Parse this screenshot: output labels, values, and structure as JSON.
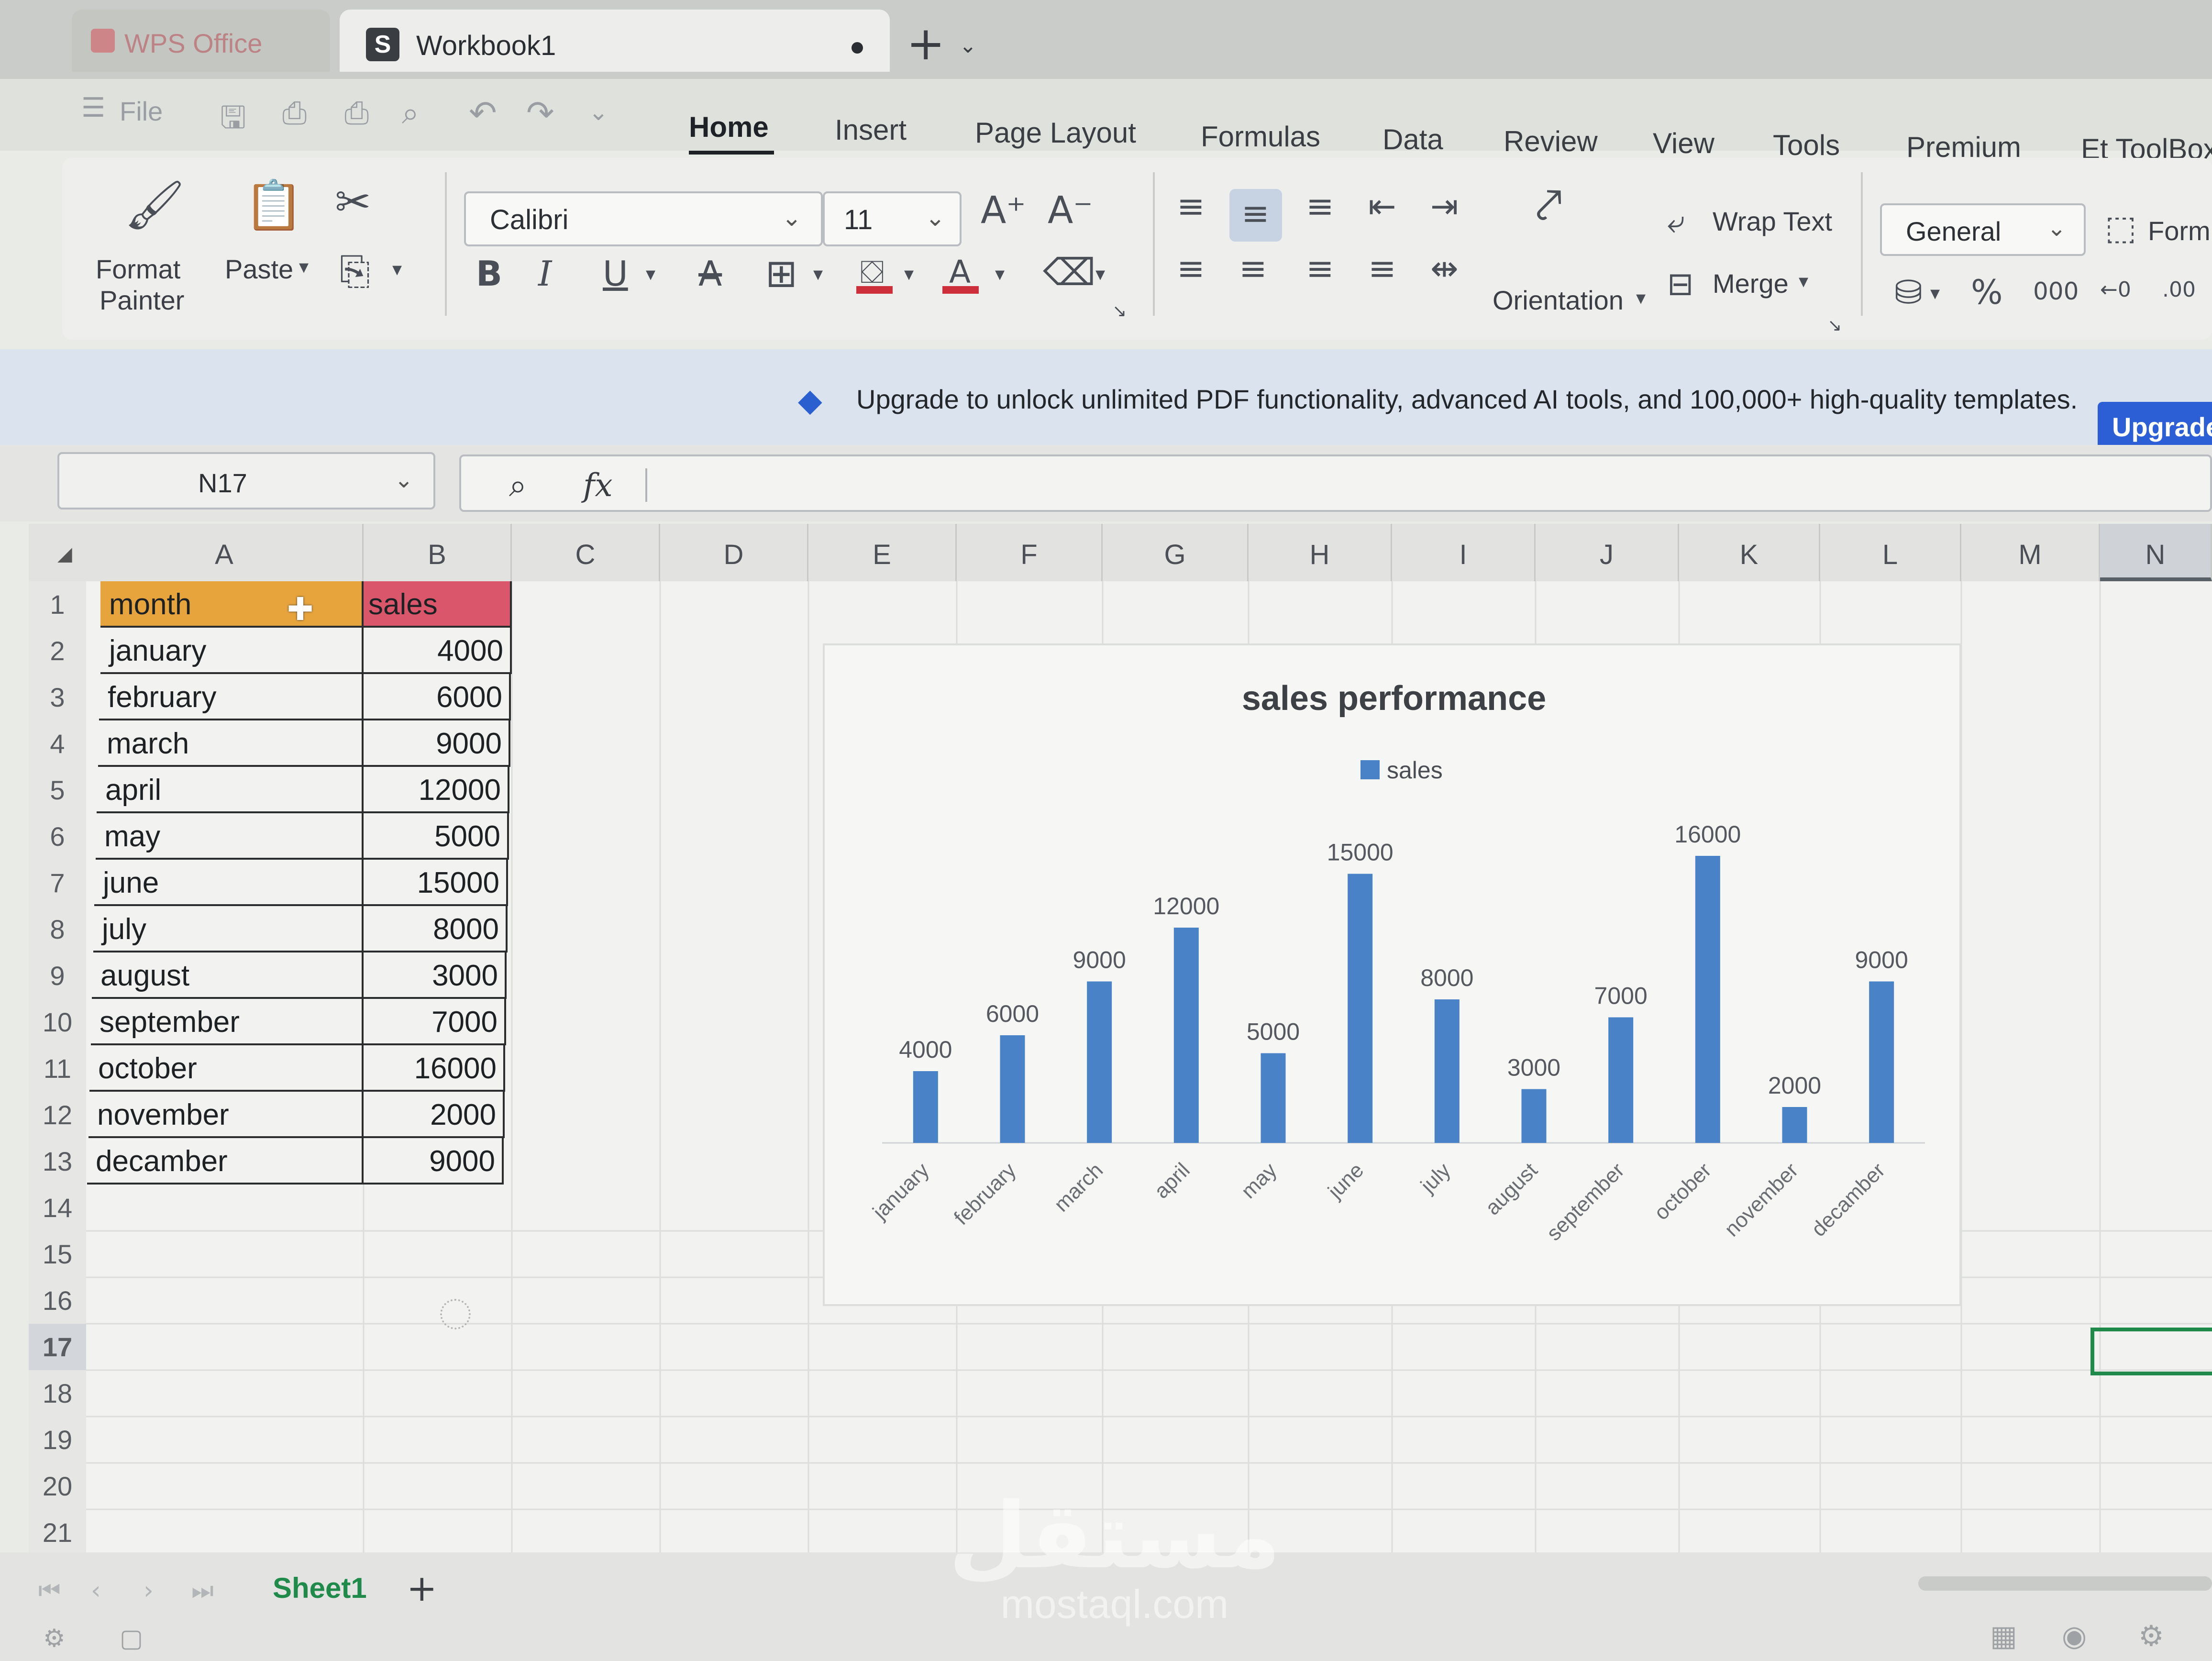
{
  "window": {
    "app_tab": "WPS Office",
    "doc_tab": "Workbook1",
    "doc_icon": "S",
    "new_tab_glyph": "+"
  },
  "menu": {
    "file": "File",
    "tabs": [
      "Home",
      "Insert",
      "Page Layout",
      "Formulas",
      "Data",
      "Review",
      "View",
      "Tools",
      "Premium",
      "Et ToolBox"
    ],
    "active_tab": "Home"
  },
  "ribbon": {
    "format_painter": "Format Painter",
    "format_painter_line1": "Format",
    "format_painter_line2": "Painter",
    "paste": "Paste",
    "font_name": "Calibri",
    "font_size": "11",
    "wrap_text": "Wrap Text",
    "orientation": "Orientation",
    "merge": "Merge",
    "number_format": "General",
    "format_btn": "Form"
  },
  "banner": {
    "text": "Upgrade to unlock unlimited PDF functionality, advanced AI tools, and 100,000+ high-quality templates.",
    "button": "Upgrade"
  },
  "formula_bar": {
    "name_box": "N17",
    "fx": "fx",
    "value": ""
  },
  "sheet": {
    "columns": [
      "A",
      "B",
      "C",
      "D",
      "E",
      "F",
      "G",
      "H",
      "I",
      "J",
      "K",
      "L",
      "M",
      "N"
    ],
    "selected_column": "N",
    "selected_row": "17",
    "rows": [
      "1",
      "2",
      "3",
      "4",
      "5",
      "6",
      "7",
      "8",
      "9",
      "10",
      "11",
      "12",
      "13",
      "14",
      "15",
      "16",
      "17",
      "18",
      "19",
      "20",
      "21"
    ],
    "header": {
      "a": "month",
      "b": "sales"
    },
    "data": [
      {
        "month": "january",
        "sales": "4000"
      },
      {
        "month": "february",
        "sales": "6000"
      },
      {
        "month": "march",
        "sales": "9000"
      },
      {
        "month": "april",
        "sales": "12000"
      },
      {
        "month": "may",
        "sales": "5000"
      },
      {
        "month": "june",
        "sales": "15000"
      },
      {
        "month": "july",
        "sales": "8000"
      },
      {
        "month": "august",
        "sales": "3000"
      },
      {
        "month": "september",
        "sales": "7000"
      },
      {
        "month": "october",
        "sales": "16000"
      },
      {
        "month": "november",
        "sales": "2000"
      },
      {
        "month": "decamber",
        "sales": "9000"
      }
    ],
    "header_colors": {
      "a": "#e8a43c",
      "b": "#d9566b"
    }
  },
  "chart_data": {
    "type": "bar",
    "title": "sales performance",
    "legend": "top",
    "categories": [
      "january",
      "february",
      "march",
      "april",
      "may",
      "june",
      "july",
      "august",
      "september",
      "october",
      "november",
      "decamber"
    ],
    "series": [
      {
        "name": "sales",
        "values": [
          4000,
          6000,
          9000,
          12000,
          5000,
          15000,
          8000,
          3000,
          7000,
          16000,
          2000,
          9000
        ]
      }
    ],
    "data_labels": [
      "4000",
      "6000",
      "9000",
      "12000",
      "5000",
      "15000",
      "8000",
      "3000",
      "7000",
      "16000",
      "2000",
      "9000"
    ],
    "ylim": [
      0,
      16000
    ],
    "bar_color": "#4a82c8",
    "grid": false
  },
  "bottom": {
    "sheet_tab": "Sheet1",
    "add_sheet": "+"
  },
  "watermark": {
    "arabic": "مستقل",
    "latin": "mostaql.com"
  },
  "icons": {
    "save": "save-icon",
    "undo": "undo-icon",
    "redo": "redo-icon",
    "print": "print-icon",
    "cut": "scissors-icon",
    "bold": "B",
    "italic": "I",
    "underline": "U"
  }
}
